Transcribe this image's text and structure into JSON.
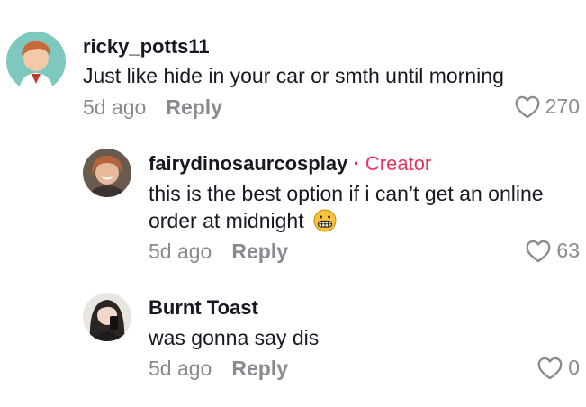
{
  "comments": [
    {
      "username": "ricky_potts11",
      "text": "Just like hide in your car or smth until morning",
      "time": "5d ago",
      "reply_label": "Reply",
      "likes": "270"
    },
    {
      "username": "fairydinosaurcosplay",
      "separator": "·",
      "badge": "Creator",
      "text_line1": "this is the best option if i can’t get an online",
      "text_line2": "order at midnight",
      "time": "5d ago",
      "reply_label": "Reply",
      "likes": "63"
    },
    {
      "username": "Burnt Toast",
      "text": "was gonna say dis",
      "time": "5d ago",
      "reply_label": "Reply",
      "likes": "0"
    }
  ],
  "colors": {
    "accent": "#e6365f",
    "muted": "#8a8b91",
    "text": "#161823"
  },
  "icons": [
    "heart-outline-icon",
    "grimacing-face-emoji"
  ]
}
